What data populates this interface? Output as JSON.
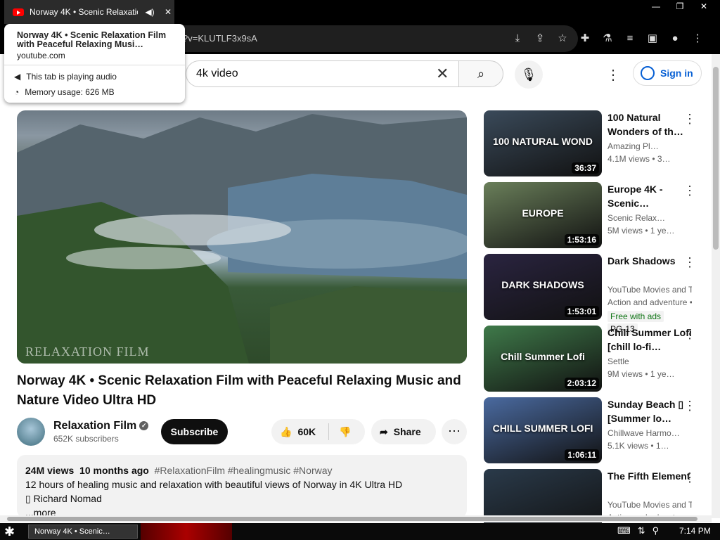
{
  "browser": {
    "tab_title": "Norway 4K • Scenic Relaxation",
    "url_visible": "?v=KLUTLF3x9sA"
  },
  "tooltip": {
    "title": "Norway 4K • Scenic Relaxation Film with Peaceful Relaxing Musi…",
    "domain": "youtube.com",
    "audio": "This tab is playing audio",
    "memory": "Memory usage: 626 MB"
  },
  "header": {
    "search_value": "4k video",
    "signin": "Sign in"
  },
  "video": {
    "watermark": "RELAXATION FILM",
    "title": "Norway 4K • Scenic Relaxation Film with Peaceful Relaxing Music and Nature Video Ultra HD",
    "channel": "Relaxation Film",
    "subscribers": "652K subscribers",
    "subscribe": "Subscribe",
    "likes": "60K",
    "share": "Share",
    "views": "24M views",
    "age": "10 months ago",
    "tags": "#RelaxationFilm #healingmusic #Norway",
    "desc1": "12 hours of healing music and relaxation with beautiful views of Norway in 4K Ultra HD",
    "desc2": "▯ Richard Nomad",
    "more": "...more"
  },
  "recs": [
    {
      "title": "100 Natural Wonders of th…",
      "channel": "Amazing Pl…",
      "views": "4.1M views • 3…",
      "dur": "36:37",
      "overlay": "100 NATURAL WOND",
      "bg": "#3a4a5a"
    },
    {
      "title": "Europe 4K - Scenic…",
      "channel": "Scenic Relax…",
      "views": "5M views • 1 ye…",
      "dur": "1:53:16",
      "overlay": "EUROPE",
      "bg": "#6a7f5a"
    },
    {
      "title": "Dark Shadows",
      "channel": "YouTube Movies and TV",
      "views": "Action and adventure •",
      "dur": "1:53:01",
      "overlay": "DARK SHADOWS",
      "bg": "#2a2440",
      "badge1": "Free with ads",
      "badge2": "PG-13"
    },
    {
      "title": "Chill Summer Lofi [chill lo-fi…",
      "channel": "Settle",
      "views": "9M views • 1 ye…",
      "dur": "2:03:12",
      "overlay": "Chill Summer Lofi",
      "bg": "#3f7a4a"
    },
    {
      "title": "Sunday Beach ▯ [Summer lo…",
      "channel": "Chillwave Harmo…",
      "views": "5.1K views • 1…",
      "dur": "1:06:11",
      "overlay": "CHILL SUMMER LOFI",
      "bg": "#4a6aa0"
    },
    {
      "title": "The Fifth Element",
      "channel": "YouTube Movies and TV",
      "views": "Action and adventure •",
      "dur": "",
      "overlay": "",
      "bg": "#2a3a4a"
    }
  ],
  "taskbar": {
    "task": "Norway 4K • Scenic…",
    "time": "7:14 PM"
  }
}
